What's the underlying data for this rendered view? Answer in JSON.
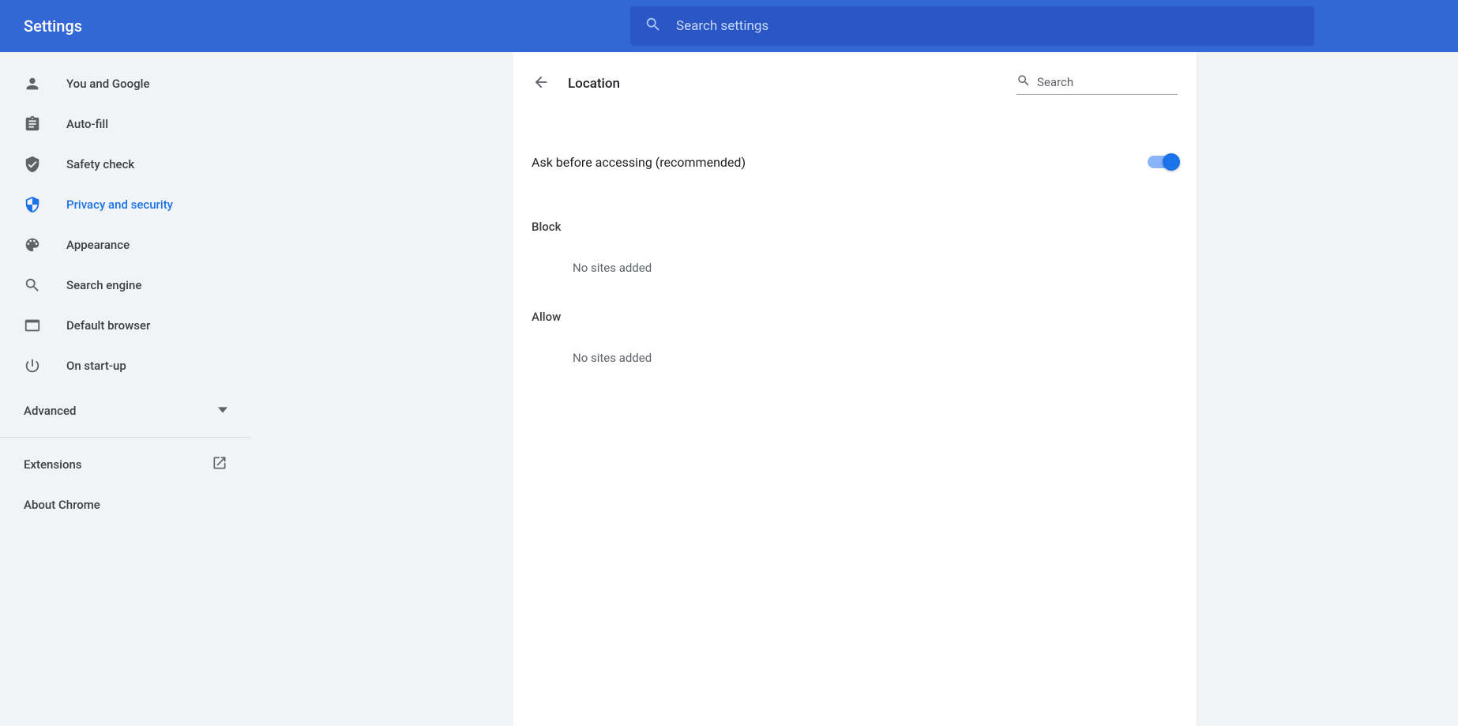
{
  "header": {
    "title": "Settings",
    "search_placeholder": "Search settings"
  },
  "sidebar": {
    "items": [
      {
        "label": "You and Google"
      },
      {
        "label": "Auto-fill"
      },
      {
        "label": "Safety check"
      },
      {
        "label": "Privacy and security"
      },
      {
        "label": "Appearance"
      },
      {
        "label": "Search engine"
      },
      {
        "label": "Default browser"
      },
      {
        "label": "On start-up"
      }
    ],
    "advanced_label": "Advanced",
    "extensions_label": "Extensions",
    "about_label": "About Chrome"
  },
  "page": {
    "title": "Location",
    "search_placeholder": "Search",
    "toggle_label": "Ask before accessing (recommended)",
    "block_header": "Block",
    "block_empty": "No sites added",
    "allow_header": "Allow",
    "allow_empty": "No sites added"
  }
}
